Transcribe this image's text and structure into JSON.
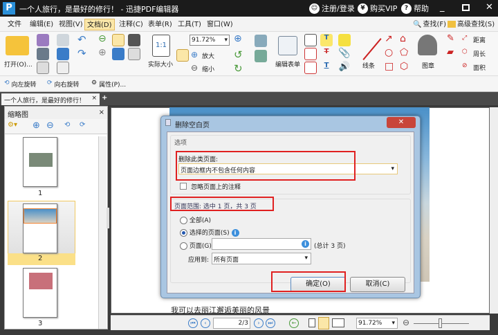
{
  "title_bar": {
    "title": "一个人旅行，是最好的修行！ - 迅捷PDF编辑器",
    "register": "注册/登录",
    "vip": "购买VIP",
    "help": "帮助"
  },
  "menu": [
    "文件",
    "编辑(E)",
    "视图(V)",
    "文档(D)",
    "注释(C)",
    "表单(R)",
    "工具(T)",
    "窗口(W)"
  ],
  "menu_right": {
    "find": "查找(F)",
    "advanced_find": "高级查找(S)"
  },
  "ribbon": {
    "open": "打开(O)...",
    "actual_size": "实际大小",
    "zoom_value": "91.72%",
    "zoom_in": "放大",
    "zoom_out": "缩小",
    "edit_form": "编辑表单",
    "lines": "线条",
    "stamp": "图章",
    "distance": "距离",
    "perimeter": "周长",
    "area": "面积"
  },
  "quick": {
    "rotate_left": "向左旋转",
    "rotate_right": "向右旋转",
    "properties": "属性(P)..."
  },
  "doc_tab": {
    "label": "一个人旅行，是最好的修行！"
  },
  "thumbnails": {
    "title": "缩略图",
    "pages": [
      "1",
      "2",
      "3"
    ],
    "selected": "2"
  },
  "dialog": {
    "title": "删除空白页",
    "options_label": "选项",
    "delete_type_label": "删除此类页面:",
    "delete_type_value": "页面边框内不包含任何内容",
    "ignore_annotations": "忽略页面上的注释",
    "range_label": "页面范围: 选中 1 页，共 3 页",
    "radio_all": "全部(A)",
    "radio_selected": "选择的页面(S)",
    "radio_pages": "页面(G)",
    "pages_input": "",
    "total": "(总计 3 页)",
    "apply_to_label": "应用到:",
    "apply_to_value": "所有页面",
    "ok": "确定(O)",
    "cancel": "取消(C)"
  },
  "doc_text": "我可以去丽江邂逅美丽的风景",
  "status": {
    "page": "2/3",
    "zoom": "91.72%"
  },
  "colors": {
    "accent": "#fbe7a8",
    "highlight": "#e02020"
  }
}
